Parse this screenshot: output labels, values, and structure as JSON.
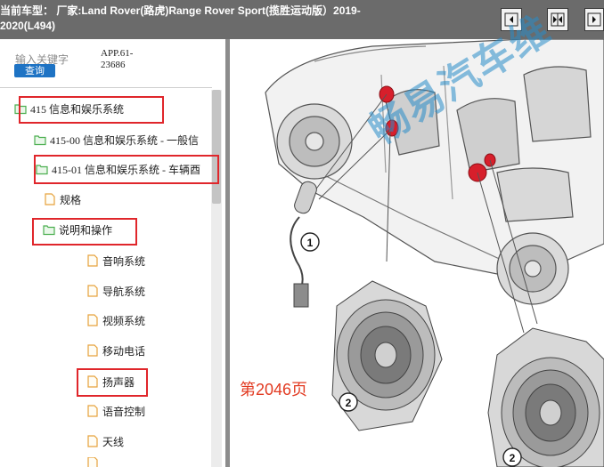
{
  "header": {
    "title": "当前车型：  厂家:Land Rover(路虎)Range Rover Sport(揽胜运动版）2019-2020(L494)",
    "buttons": [
      "single-page",
      "two-page",
      "fit-page"
    ]
  },
  "search": {
    "hint": "输入关键字",
    "button_label": "查询"
  },
  "app_code": [
    "APP.61-",
    "23686"
  ],
  "tree": {
    "items": [
      {
        "label": "415 信息和娱乐系统",
        "icon": "folder-open-icon"
      },
      {
        "label": "415-00 信息和娱乐系统 - 一般信",
        "icon": "folder-open-icon"
      },
      {
        "label": "415-01 信息和娱乐系统 - 车辆酉",
        "icon": "folder-open-icon"
      },
      {
        "label": "规格",
        "icon": "document-icon"
      },
      {
        "label": "说明和操作",
        "icon": "folder-open-icon"
      },
      {
        "label": "音响系统",
        "icon": "document-icon"
      },
      {
        "label": "导航系统",
        "icon": "document-icon"
      },
      {
        "label": "视频系统",
        "icon": "document-icon"
      },
      {
        "label": "移动电话",
        "icon": "document-icon"
      },
      {
        "label": "扬声器",
        "icon": "document-icon"
      },
      {
        "label": "语音控制",
        "icon": "document-icon"
      },
      {
        "label": "天线",
        "icon": "document-icon"
      }
    ]
  },
  "document": {
    "page_number": "第2046页",
    "watermark": "畅易汽车维",
    "callouts": [
      "1",
      "2",
      "2"
    ]
  },
  "colors": {
    "header_bg": "#6b6b6b",
    "highlight": "#e0262b",
    "search_button": "#1e73c4",
    "folder": "#4caf50",
    "document_icon": "#e6a23c",
    "page_number": "#e23b22"
  }
}
